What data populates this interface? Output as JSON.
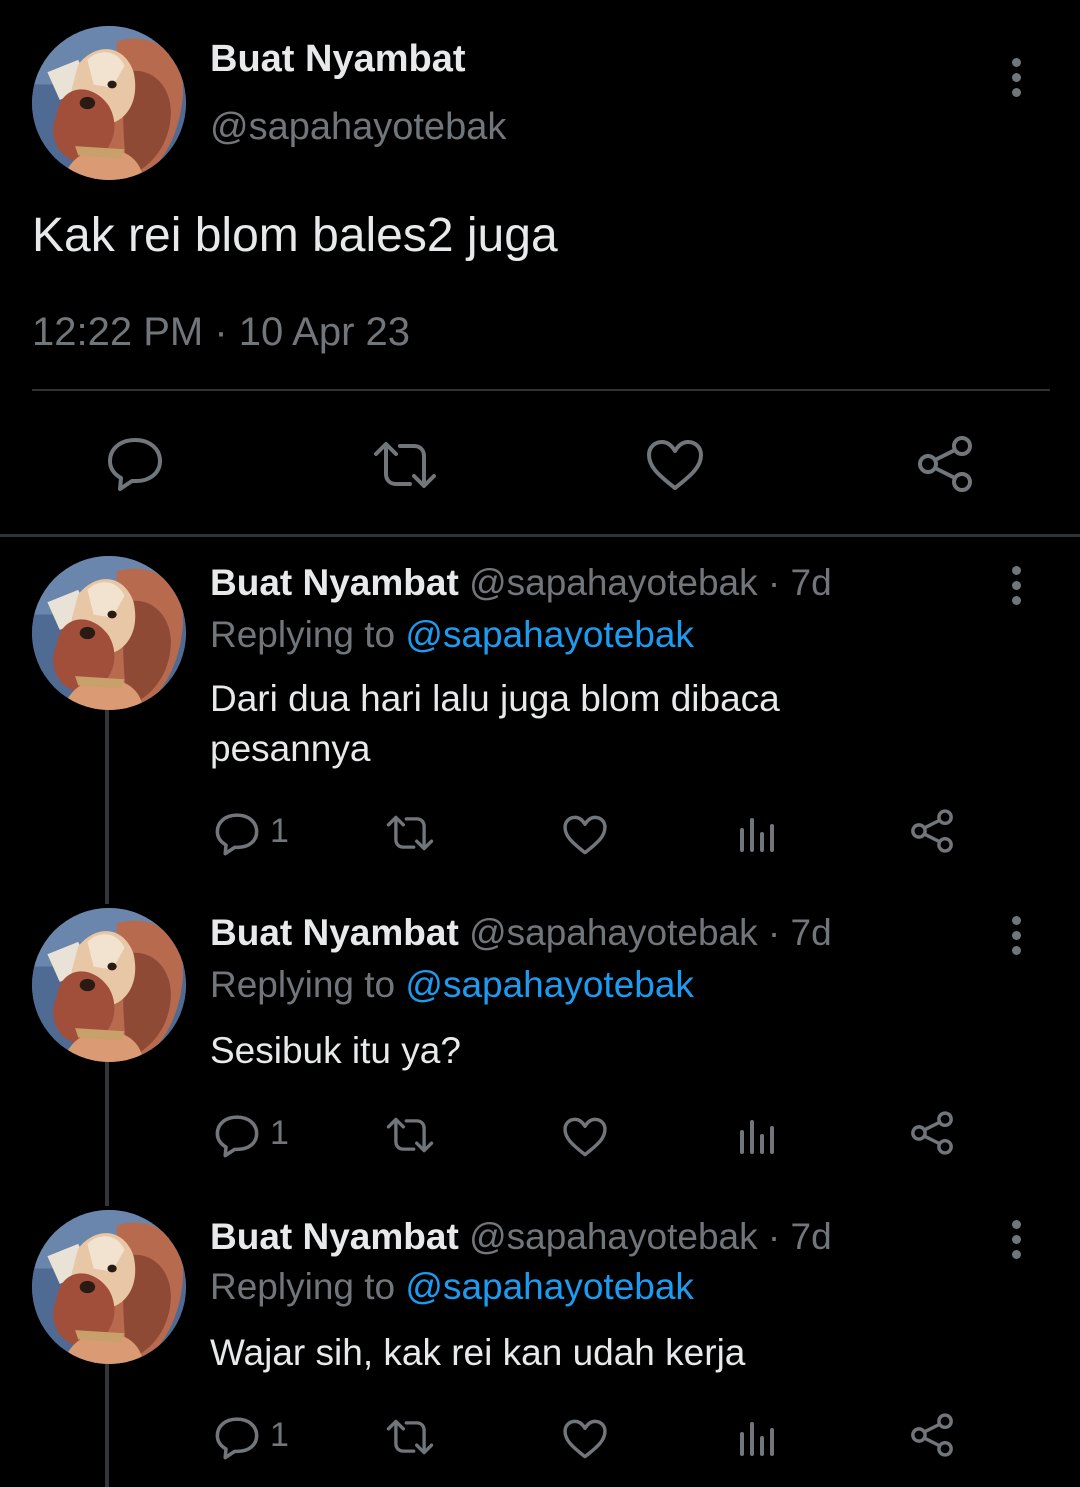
{
  "main_tweet": {
    "display_name": "Buat Nyambat",
    "handle": "@sapahayotebak",
    "text": "Kak rei blom bales2 juga",
    "timestamp": "12:22 PM · 10 Apr 23",
    "avatar": "dog-avatar",
    "actions": [
      "reply-icon",
      "retweet-icon",
      "like-icon",
      "share-icon"
    ]
  },
  "replies": [
    {
      "display_name": "Buat Nyambat",
      "handle": "@sapahayotebak",
      "age": "· 7d",
      "replying_prefix": "Replying to ",
      "replying_to": "@sapahayotebak",
      "text": "Dari dua hari lalu juga blom dibaca pesannya",
      "reply_count": "1"
    },
    {
      "display_name": "Buat Nyambat",
      "handle": "@sapahayotebak",
      "age": "· 7d",
      "replying_prefix": "Replying to ",
      "replying_to": "@sapahayotebak",
      "text": "Sesibuk itu ya?",
      "reply_count": "1"
    },
    {
      "display_name": "Buat Nyambat",
      "handle": "@sapahayotebak",
      "age": "· 7d",
      "replying_prefix": "Replying to ",
      "replying_to": "@sapahayotebak",
      "text": "Wajar sih, kak rei kan udah kerja",
      "reply_count": "1"
    }
  ],
  "colors": {
    "background": "#000000",
    "text": "#e7e9ea",
    "secondary": "#71767b",
    "link": "#1d9bf0",
    "divider": "#2f3336"
  }
}
